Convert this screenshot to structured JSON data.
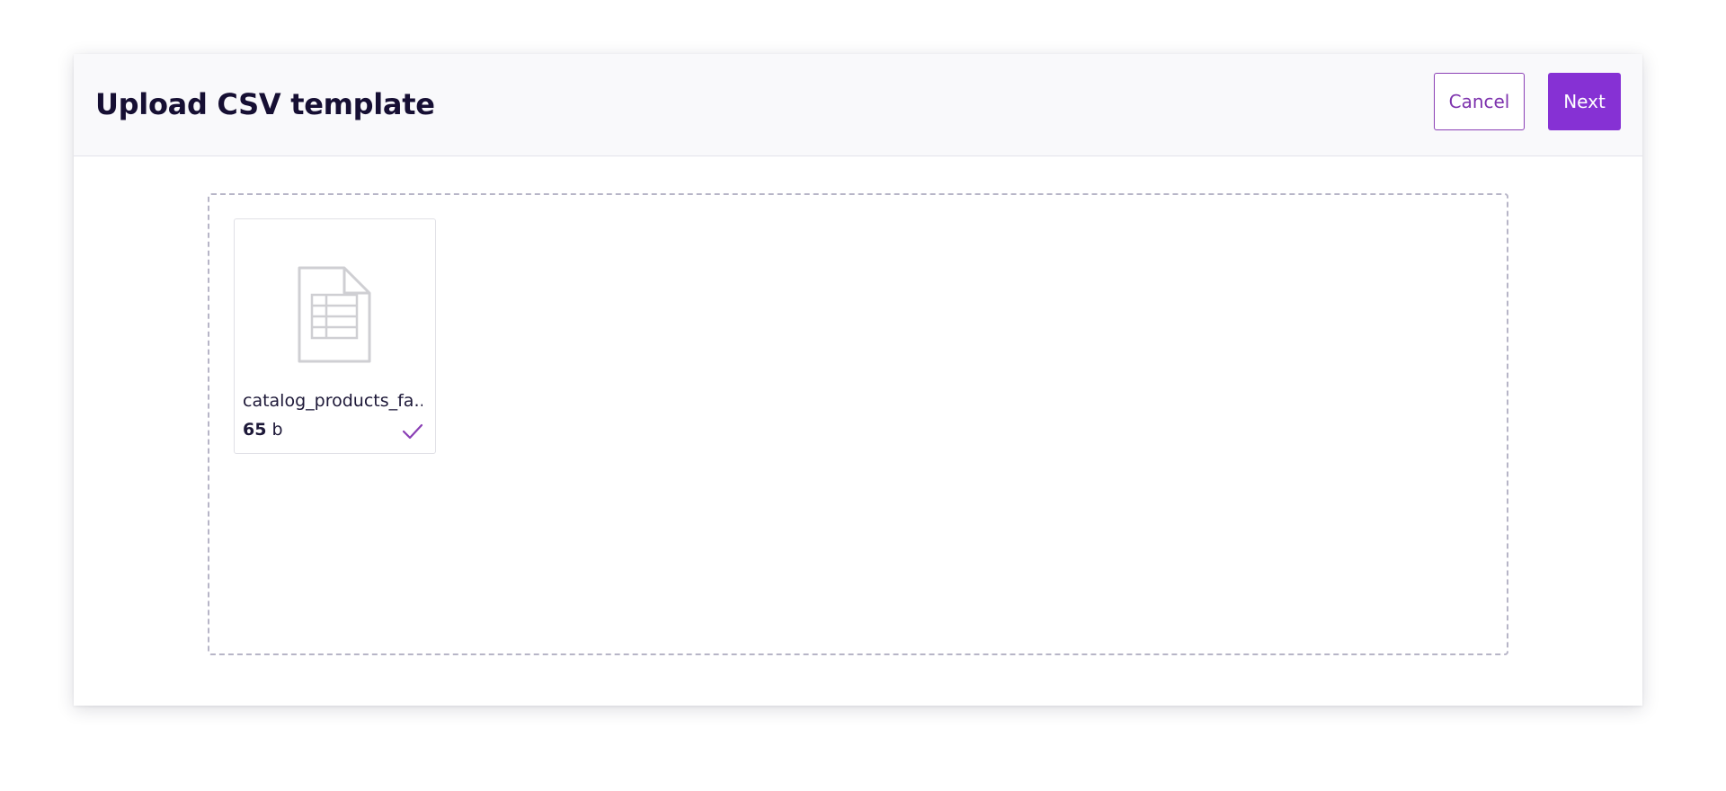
{
  "header": {
    "title": "Upload CSV template",
    "cancel_label": "Cancel",
    "next_label": "Next"
  },
  "dropzone": {
    "files": [
      {
        "name": "catalog_products_fa...",
        "size_value": "65",
        "size_unit": "b",
        "status_icon": "check-icon",
        "file_icon": "spreadsheet-file-icon"
      }
    ]
  },
  "colors": {
    "accent": "#8631d4",
    "accent_outline": "#8a3fb5",
    "title_text": "#160f33",
    "dropzone_border": "#b7b5c7",
    "icon_gray": "#cfcfd3"
  }
}
